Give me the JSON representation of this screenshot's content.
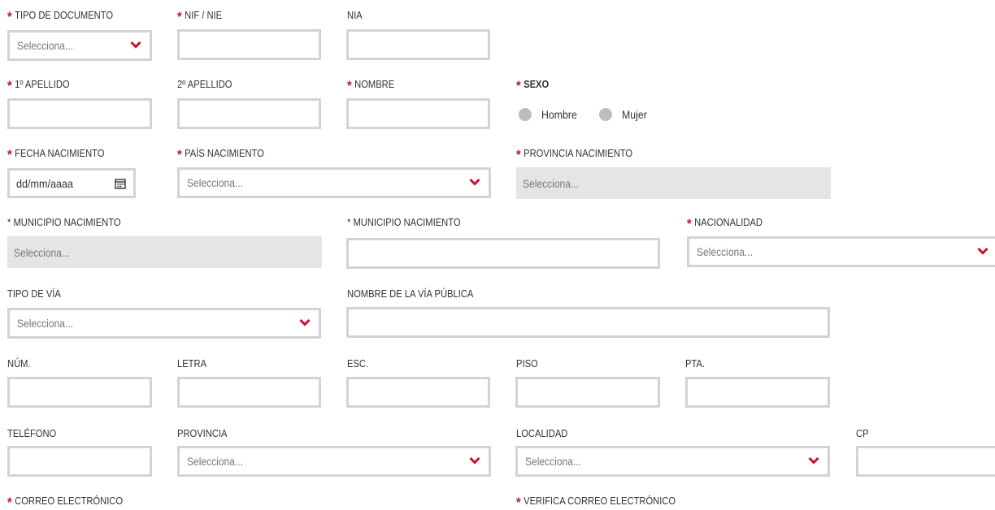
{
  "form": {
    "asterisk": "*",
    "select_placeholder": "Selecciona...",
    "tipo_documento": {
      "label": "TIPO DE DOCUMENTO",
      "placeholder": "Selecciona..."
    },
    "nif_nie": {
      "label": "NIF / NIE",
      "value": ""
    },
    "nia": {
      "label": "NIA",
      "value": ""
    },
    "apellido1": {
      "label": "1º APELLIDO",
      "value": ""
    },
    "apellido2": {
      "label": "2º APELLIDO",
      "value": ""
    },
    "nombre": {
      "label": "NOMBRE",
      "value": ""
    },
    "sexo": {
      "label": "SEXO",
      "options": [
        "Hombre",
        "Mujer"
      ]
    },
    "fecha_nacimiento": {
      "label": "FECHA NACIMIENTO",
      "placeholder": "dd/mm/aaaa"
    },
    "pais_nacimiento": {
      "label": "PAÍS NACIMIENTO",
      "placeholder": "Selecciona..."
    },
    "provincia_nacimiento": {
      "label": "PROVINCIA NACIMIENTO",
      "placeholder": "Selecciona..."
    },
    "municipio_nacimiento_1": {
      "label": "* MUNICIPIO NACIMIENTO",
      "placeholder": "Selecciona..."
    },
    "municipio_nacimiento_2": {
      "label": "* MUNICIPIO NACIMIENTO",
      "value": ""
    },
    "nacionalidad": {
      "label": "NACIONALIDAD",
      "placeholder": "Selecciona..."
    },
    "tipo_via": {
      "label": "TIPO DE VÍA",
      "placeholder": "Selecciona..."
    },
    "nombre_via": {
      "label": "NOMBRE DE LA VÍA PÚBLICA",
      "value": ""
    },
    "num": {
      "label": "NÚM.",
      "value": ""
    },
    "letra": {
      "label": "LETRA",
      "value": ""
    },
    "esc": {
      "label": "ESC.",
      "value": ""
    },
    "piso": {
      "label": "PISO",
      "value": ""
    },
    "pta": {
      "label": "PTA.",
      "value": ""
    },
    "telefono": {
      "label": "TELÉFONO",
      "value": ""
    },
    "provincia": {
      "label": "PROVINCIA",
      "placeholder": "Selecciona..."
    },
    "localidad": {
      "label": "LOCALIDAD",
      "placeholder": "Selecciona..."
    },
    "cp": {
      "label": "CP",
      "value": ""
    },
    "correo": {
      "label": "CORREO ELECTRÓNICO"
    },
    "verifica_correo": {
      "label": "VERIFICA CORREO ELECTRÓNICO"
    }
  },
  "colors": {
    "accent": "#c8102e",
    "border": "#d3d3d3",
    "disabled": "#e5e5e5"
  },
  "icons": {
    "select": "chevron-down-icon",
    "date": "calendar-icon"
  }
}
